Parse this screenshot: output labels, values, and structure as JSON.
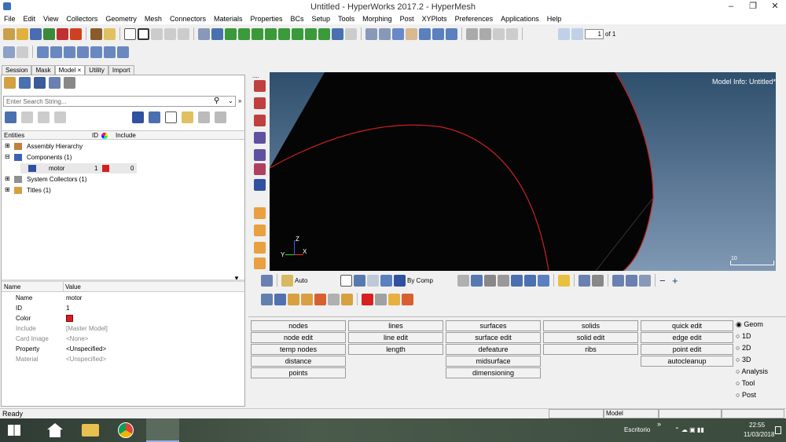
{
  "window": {
    "title": "Untitled - HyperWorks 2017.2 - HyperMesh",
    "controls": [
      "minimize-icon",
      "restore-icon",
      "close-icon"
    ]
  },
  "menu": [
    "File",
    "Edit",
    "View",
    "Collectors",
    "Geometry",
    "Mesh",
    "Connectors",
    "Materials",
    "Properties",
    "BCs",
    "Setup",
    "Tools",
    "Morphing",
    "Post",
    "XYPlots",
    "Preferences",
    "Applications",
    "Help"
  ],
  "page_nav": {
    "current": "1",
    "of_label": "of 1"
  },
  "tabs": [
    {
      "label": "Session"
    },
    {
      "label": "Mask"
    },
    {
      "label": "Model",
      "close": "×"
    },
    {
      "label": "Utility"
    },
    {
      "label": "Import"
    }
  ],
  "search": {
    "placeholder": "Enter Search String..."
  },
  "entities_table": {
    "headers": {
      "entities": "Entities",
      "id": "ID",
      "include": "Include"
    },
    "rows": [
      {
        "label": "Assembly Hierarchy"
      },
      {
        "label": "Components (1)"
      },
      {
        "label": "motor",
        "id": "1",
        "include": "0"
      },
      {
        "label": "System Collectors (1)"
      },
      {
        "label": "Titles (1)"
      }
    ]
  },
  "properties": {
    "headers": {
      "name": "Name",
      "value": "Value"
    },
    "rows": [
      {
        "name": "Name",
        "value": "motor",
        "editable": true
      },
      {
        "name": "ID",
        "value": "1",
        "editable": true
      },
      {
        "name": "Color",
        "value": "",
        "editable": true
      },
      {
        "name": "Include",
        "value": "[Master Model]",
        "editable": false
      },
      {
        "name": "Card Image",
        "value": "<None>",
        "editable": false
      },
      {
        "name": "Property",
        "value": "<Unspecified>",
        "editable": true
      },
      {
        "name": "Material",
        "value": "<Unspecified>",
        "editable": false
      }
    ]
  },
  "viewport": {
    "model_info": "Model Info: Untitled*",
    "scale_label": "10",
    "axes": {
      "x": "X",
      "y": "Y",
      "z": "Z"
    }
  },
  "viewbar": {
    "auto_label": "Auto",
    "color_mode": "By Comp"
  },
  "panel_menu": {
    "col1": [
      "nodes",
      "node edit",
      "temp nodes",
      "distance",
      "points"
    ],
    "col2": [
      "lines",
      "line edit",
      "length"
    ],
    "col3": [
      "surfaces",
      "surface edit",
      "defeature",
      "midsurface",
      "dimensioning"
    ],
    "col4": [
      "solids",
      "solid edit",
      "ribs"
    ],
    "col5": [
      "quick edit",
      "edge edit",
      "point edit",
      "autocleanup"
    ]
  },
  "page_radios": {
    "selected": "Geom",
    "options": [
      "Geom",
      "1D",
      "2D",
      "3D",
      "Analysis",
      "Tool",
      "Post"
    ]
  },
  "status": {
    "text": "Ready",
    "model_label": "Model"
  },
  "taskbar": {
    "escritorio": "Escritorio",
    "time": "22:55",
    "date": "11/03/2018",
    "chevron": "»"
  },
  "colors": {
    "component": "#d42020",
    "viewport_top": "#2e4f6d",
    "viewport_bottom": "#7f98b4",
    "edge": "#cc1f1f"
  }
}
